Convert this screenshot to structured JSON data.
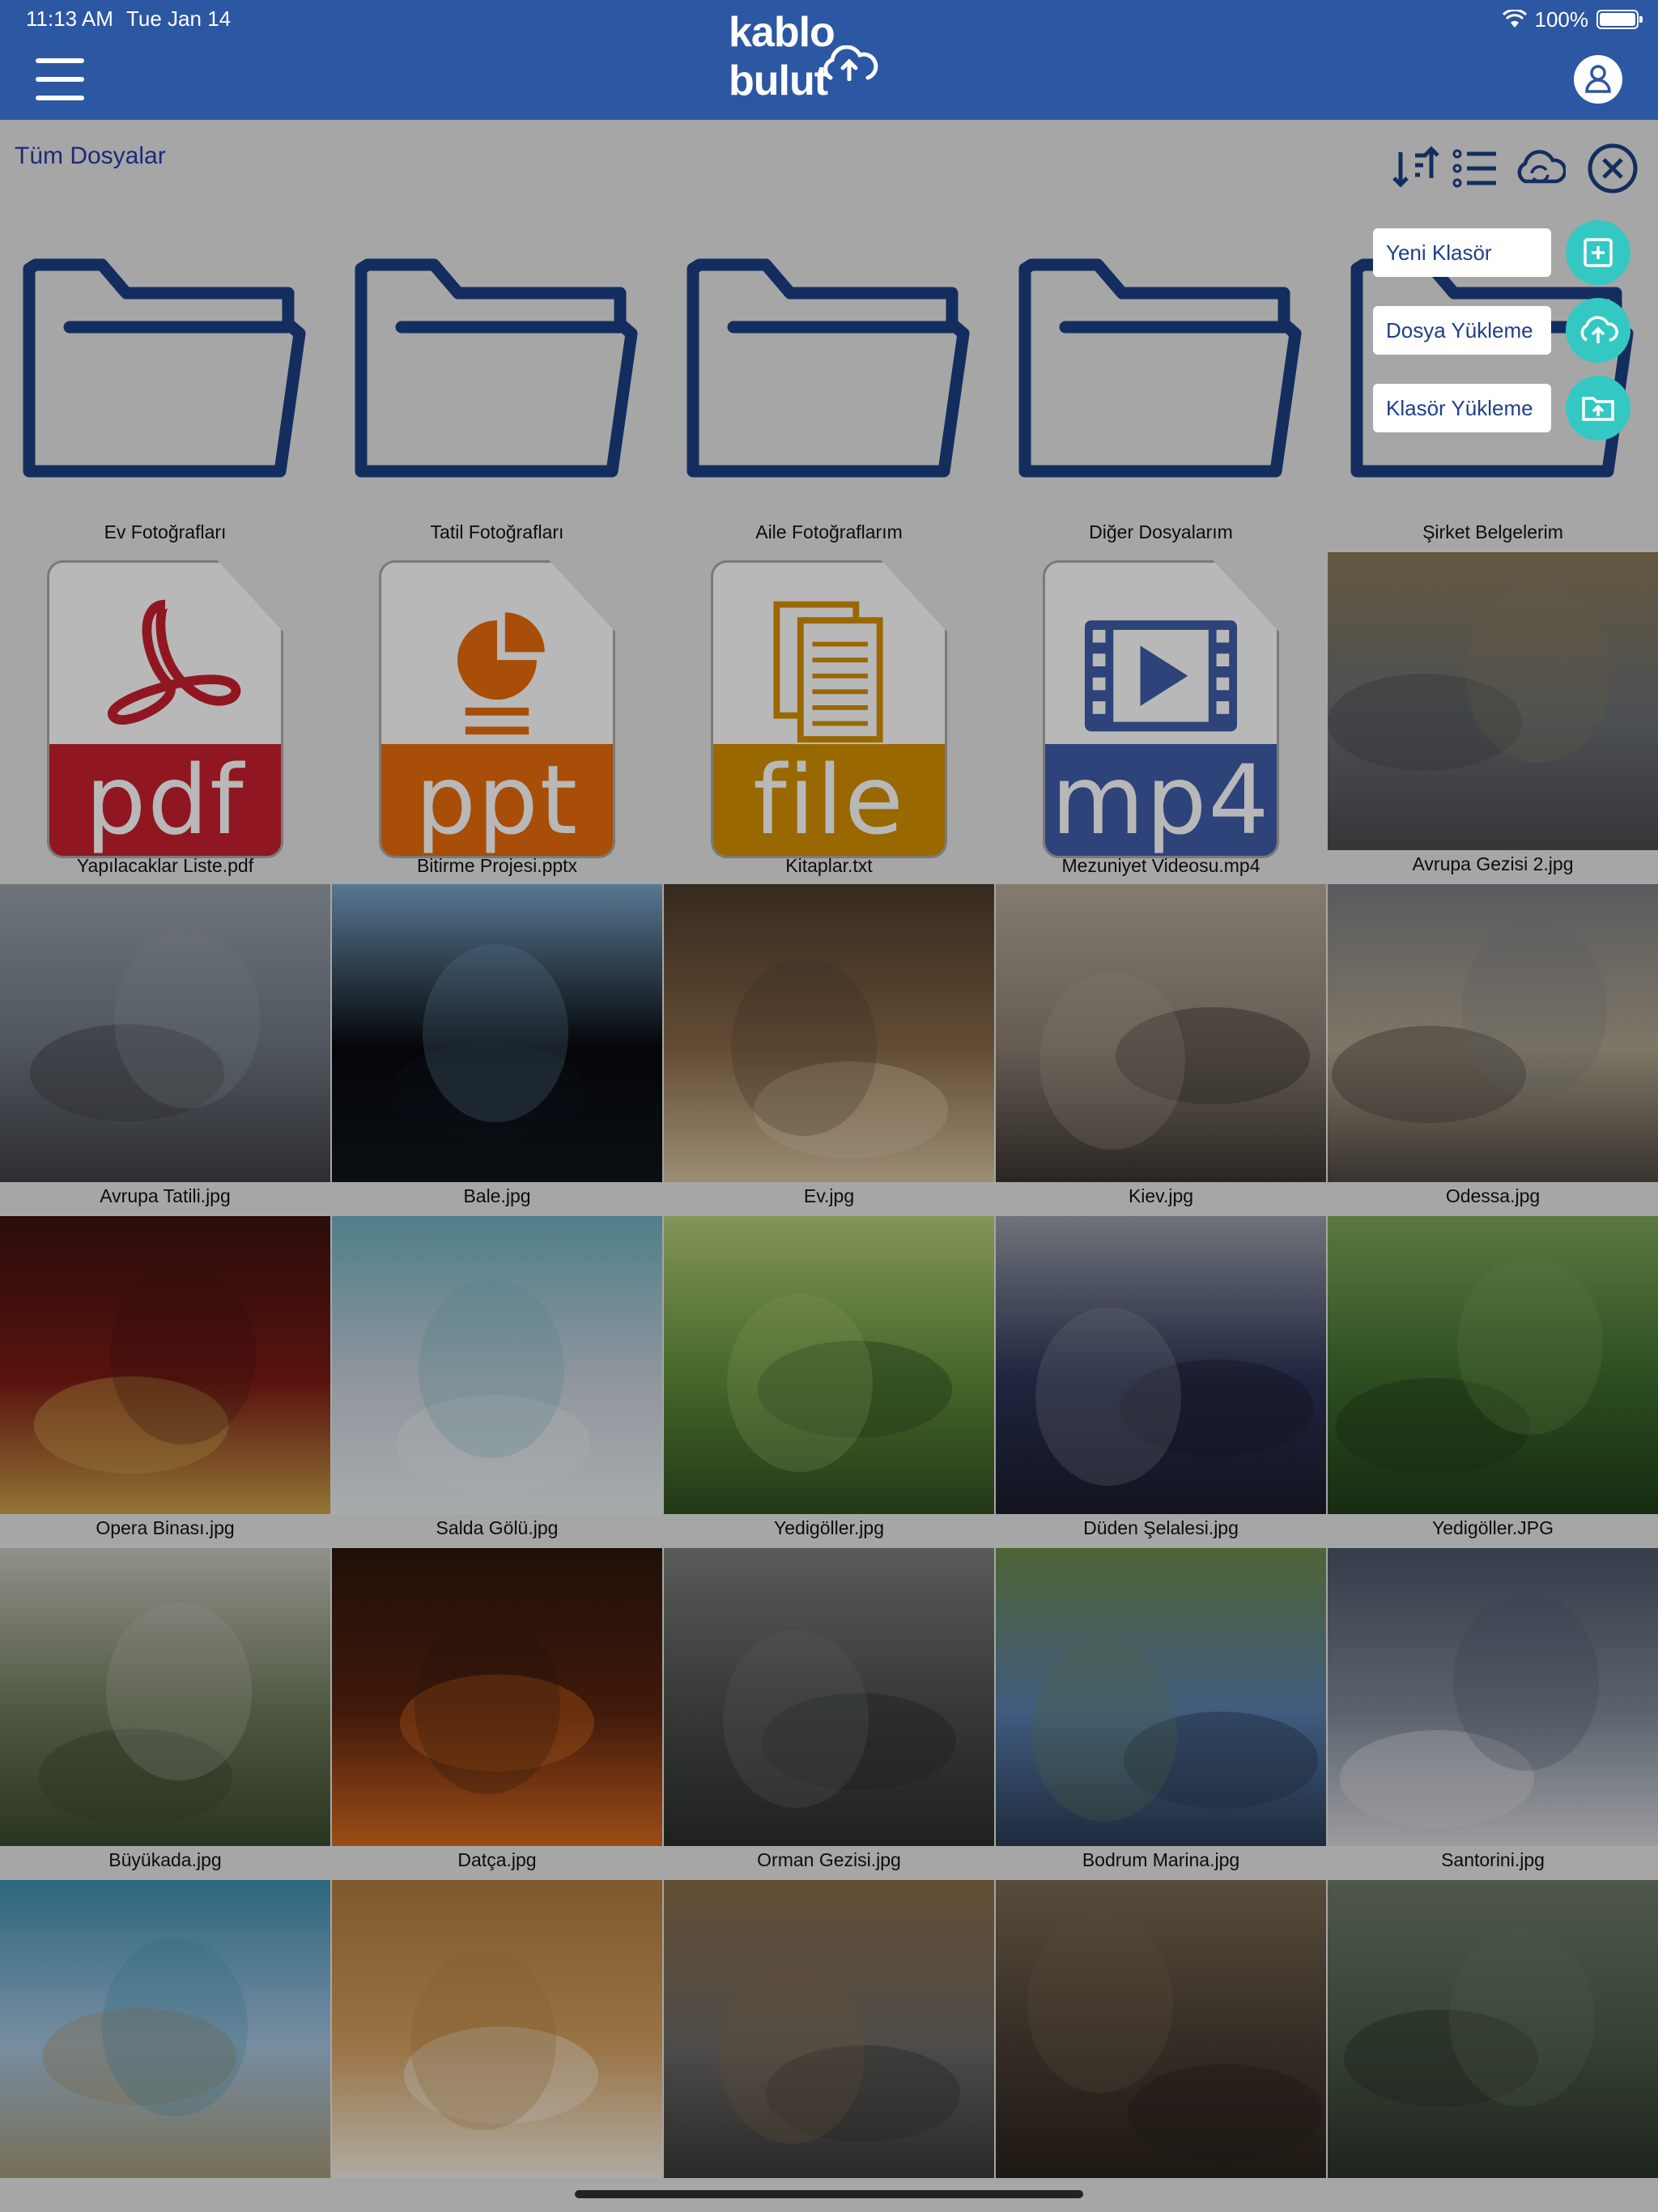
{
  "status_bar": {
    "time": "11:13 AM",
    "date": "Tue Jan 14",
    "battery": "100%",
    "battery_level": 1.0
  },
  "header": {
    "logo_text": "kablo bulut",
    "menu_icon": "hamburger-icon",
    "profile_icon": "user-icon"
  },
  "breadcrumb": "Tüm Dosyalar",
  "toolbar": {
    "icons": [
      "sort-icon",
      "list-view-icon",
      "cloud-sync-icon",
      "close-icon"
    ]
  },
  "fab_menu": [
    {
      "label": "Yeni Klasör",
      "icon": "plus-square-icon"
    },
    {
      "label": "Dosya Yükleme",
      "icon": "cloud-upload-icon"
    },
    {
      "label": "Klasör Yükleme",
      "icon": "folder-upload-icon"
    }
  ],
  "colors": {
    "header": "#2c57a3",
    "folder_stroke": "#1c3f84",
    "accent": "#33c9c2",
    "pdf": "#c8202f",
    "ppt": "#e96c0c",
    "file": "#d49100",
    "mp4": "#3f5da8"
  },
  "folders": [
    {
      "name": "Ev Fotoğrafları"
    },
    {
      "name": "Tatil Fotoğrafları"
    },
    {
      "name": "Aile Fotoğraflarım"
    },
    {
      "name": "Diğer Dosyalarım"
    },
    {
      "name": "Şirket Belgelerim"
    }
  ],
  "documents": [
    {
      "name": "Yapılacaklar Liste.pdf",
      "ext": "pdf",
      "color": "#c8202f",
      "icon": "pdf-icon"
    },
    {
      "name": "Bitirme Projesi.pptx",
      "ext": "ppt",
      "color": "#e96c0c",
      "icon": "ppt-icon"
    },
    {
      "name": "Kitaplar.txt",
      "ext": "file",
      "color": "#d49100",
      "icon": "text-file-icon"
    },
    {
      "name": "Mezuniyet Videosu.mp4",
      "ext": "mp4",
      "color": "#3f5da8",
      "icon": "video-icon"
    }
  ],
  "photos": [
    {
      "name": "Avrupa Gezisi 2.jpg"
    },
    {
      "name": "Avrupa Tatili.jpg"
    },
    {
      "name": "Bale.jpg"
    },
    {
      "name": "Ev.jpg"
    },
    {
      "name": "Kiev.jpg"
    },
    {
      "name": "Odessa.jpg"
    },
    {
      "name": "Opera Binası.jpg"
    },
    {
      "name": "Salda Gölü.jpg"
    },
    {
      "name": "Yedigöller.jpg"
    },
    {
      "name": "Düden Şelalesi.jpg"
    },
    {
      "name": "Yedigöller.JPG"
    },
    {
      "name": "Büyükada.jpg"
    },
    {
      "name": "Datça.jpg"
    },
    {
      "name": "Orman Gezisi.jpg"
    },
    {
      "name": "Bodrum Marina.jpg"
    },
    {
      "name": "Santorini.jpg"
    },
    {
      "name": ""
    },
    {
      "name": ""
    },
    {
      "name": ""
    },
    {
      "name": ""
    },
    {
      "name": ""
    }
  ]
}
